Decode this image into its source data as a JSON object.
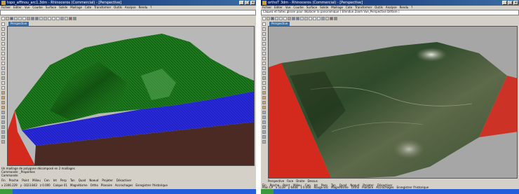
{
  "left_window": {
    "title": "topo_affinou_arc1.3dm - Rhinoceros (Commercial) - [Perspective]",
    "menu": [
      "Fichier",
      "Editer",
      "Vue",
      "Courbe",
      "Surface",
      "Solide",
      "Maillage",
      "Cote",
      "Transformer",
      "Outils",
      "Analyse",
      "Rendu",
      "?"
    ],
    "viewport_label": "Perspective",
    "message_lines": [
      "Un maillage de polygone décomposé en 2 maillages",
      "Commande: _Properties"
    ],
    "command_label": "Commande:",
    "osnap": [
      "Fin",
      "Proche",
      "Point",
      "Milieu",
      "Cen",
      "Int",
      "Perp",
      "Tan",
      "Quad",
      "Noeud",
      "Projeter",
      "Désactiver"
    ],
    "status": [
      "x 2306.229",
      "y -1023.843",
      "z 0.000",
      "Calque 01",
      "Magnétisme",
      "Ortho",
      "Planaire",
      "Accrochages",
      "Enregistrer l'historique"
    ]
  },
  "right_window": {
    "title": "orthoT 3dm - Rhinoceros (Commercial) - [Perspective]",
    "menu": [
      "Fichier",
      "Editer",
      "Vue",
      "Courbe",
      "Surface",
      "Solide",
      "Maillage",
      "Cote",
      "Transformer",
      "Outils",
      "Analyse",
      "Rendu",
      "?"
    ],
    "command_history": "Cliquez et faites glisser pour déplacer la panoramique ( Etendue Zoom Vue_Perspective Défaire )",
    "viewport_label": "Perspective",
    "tabs": [
      "Perspective",
      "Face",
      "Droite",
      "Dessus"
    ],
    "osnap": [
      "Fin",
      "Proche",
      "Point",
      "Milieu",
      "Cen",
      "Int",
      "Perp",
      "Tan",
      "Quad",
      "Noeud",
      "Projeter",
      "Désactiver"
    ],
    "status": [
      "Plan CP",
      "x 5139",
      "y 6408",
      "z 0.000",
      "Rouge Esc",
      "Magnétisme",
      "Ortho",
      "Planaire",
      "Accrochages",
      "Enregistrer l'historique"
    ]
  },
  "colors": {
    "terrain_green": "#1f7a1f",
    "water_blue": "#2a2ad8",
    "side_red": "#d42a1e",
    "titlebar": "#0a246a"
  },
  "icons": [
    "app-icon",
    "minimize-icon",
    "maximize-icon",
    "close-icon"
  ]
}
